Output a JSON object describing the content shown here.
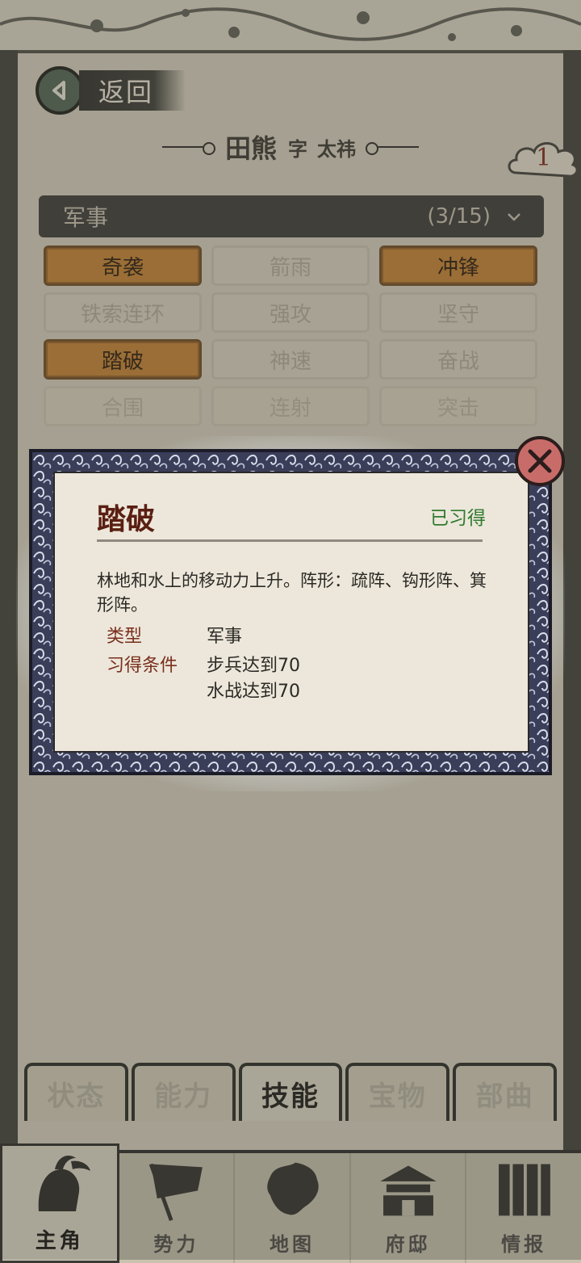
{
  "header": {
    "back_label": "返回",
    "character_name": "田熊",
    "courtesy_label": "字",
    "courtesy_name": "太祎",
    "badge_count": "1"
  },
  "category": {
    "name": "军事",
    "count": "(3/15)"
  },
  "skills": [
    {
      "label": "奇袭",
      "learned": true
    },
    {
      "label": "箭雨",
      "learned": false
    },
    {
      "label": "冲锋",
      "learned": true
    },
    {
      "label": "铁索连环",
      "learned": false
    },
    {
      "label": "强攻",
      "learned": false
    },
    {
      "label": "坚守",
      "learned": false
    },
    {
      "label": "踏破",
      "learned": true
    },
    {
      "label": "神速",
      "learned": false
    },
    {
      "label": "奋战",
      "learned": false
    },
    {
      "label": "合围",
      "learned": false
    },
    {
      "label": "连射",
      "learned": false
    },
    {
      "label": "突击",
      "learned": false
    }
  ],
  "modal": {
    "title": "踏破",
    "status": "已习得",
    "description": "林地和水上的移动力上升。阵形：疏阵、钩形阵、箕形阵。",
    "type_label": "类型",
    "type_value": "军事",
    "requirement_label": "习得条件",
    "requirement_1": "步兵达到70",
    "requirement_2": "水战达到70"
  },
  "tabs": [
    {
      "label": "状态",
      "active": false
    },
    {
      "label": "能力",
      "active": false
    },
    {
      "label": "技能",
      "active": true
    },
    {
      "label": "宝物",
      "active": false
    },
    {
      "label": "部曲",
      "active": false
    }
  ],
  "bottom_nav": [
    {
      "label": "主角",
      "icon": "warrior-portrait-icon",
      "active": true
    },
    {
      "label": "势力",
      "icon": "flag-icon",
      "active": false
    },
    {
      "label": "地图",
      "icon": "map-icon",
      "active": false
    },
    {
      "label": "府邸",
      "icon": "mansion-icon",
      "active": false
    },
    {
      "label": "情报",
      "icon": "scroll-icon",
      "active": false
    }
  ],
  "colors": {
    "learned_skill": "#c68a3e",
    "modal_title": "#5a1f12",
    "status_green": "#2f7a2f",
    "close_button": "#c86c6a"
  }
}
